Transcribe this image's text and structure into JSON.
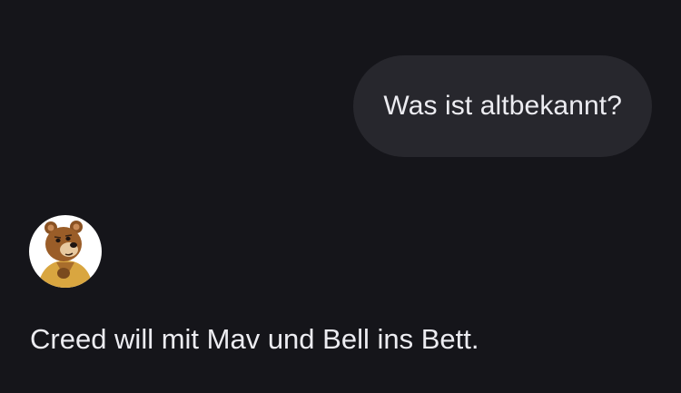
{
  "conversation": {
    "user_message": "Was ist altbekannt?",
    "assistant_avatar_icon": "bear-avatar-icon",
    "assistant_message": "Creed will mit Mav und Bell ins Bett."
  },
  "colors": {
    "background": "#15151a",
    "user_bubble": "#27272d",
    "text": "#ececf1"
  }
}
